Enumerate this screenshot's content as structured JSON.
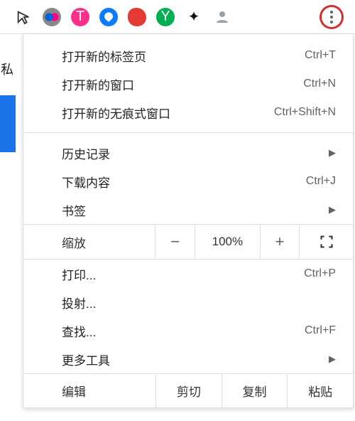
{
  "left_text": "私",
  "toolbar": {
    "icons": [
      "cursor",
      "flickr",
      "pink",
      "blue",
      "red",
      "green",
      "puzzle",
      "person"
    ],
    "more_aria": "自定义与控制 Google Chrome"
  },
  "menu": {
    "new_tab": {
      "label": "打开新的标签页",
      "shortcut": "Ctrl+T"
    },
    "new_window": {
      "label": "打开新的窗口",
      "shortcut": "Ctrl+N"
    },
    "new_incognito": {
      "label": "打开新的无痕式窗口",
      "shortcut": "Ctrl+Shift+N"
    },
    "history": {
      "label": "历史记录"
    },
    "downloads": {
      "label": "下载内容",
      "shortcut": "Ctrl+J"
    },
    "bookmarks": {
      "label": "书签"
    },
    "zoom": {
      "label": "缩放",
      "minus": "−",
      "value": "100%",
      "plus": "+"
    },
    "print": {
      "label": "打印...",
      "shortcut": "Ctrl+P"
    },
    "cast": {
      "label": "投射..."
    },
    "find": {
      "label": "查找...",
      "shortcut": "Ctrl+F"
    },
    "more_tools": {
      "label": "更多工具"
    },
    "edit": {
      "label": "编辑",
      "cut": "剪切",
      "copy": "复制",
      "paste": "粘贴"
    }
  }
}
